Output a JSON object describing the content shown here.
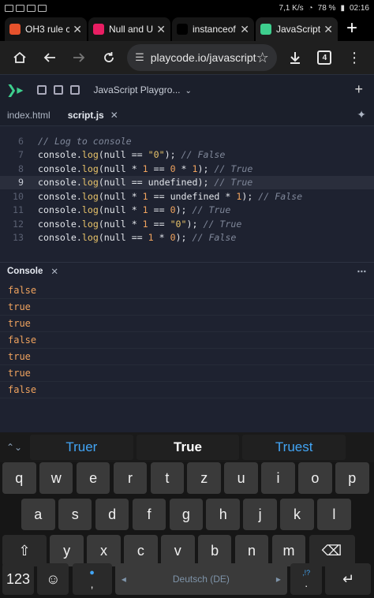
{
  "statusbar": {
    "net_speed": "7,1 K/s",
    "battery": "78 %",
    "time": "02:16"
  },
  "browser_tabs": [
    {
      "label": "OH3 rule c",
      "favicon": "openhab-icon",
      "fav_color": "#e6522c"
    },
    {
      "label": "Null and Ur",
      "favicon": "cube-icon",
      "fav_color": "#e91e63"
    },
    {
      "label": "instanceof",
      "favicon": "mdn-icon",
      "fav_color": "#000000"
    },
    {
      "label": "JavaScript",
      "favicon": "playcode-icon",
      "fav_color": "#3ecf8e"
    }
  ],
  "urlbar": {
    "url": "playcode.io/javascript",
    "tab_count": "4"
  },
  "app": {
    "project_title": "JavaScript Playgro..."
  },
  "file_tabs": [
    {
      "label": "index.html"
    },
    {
      "label": "script.js"
    }
  ],
  "code_lines": [
    {
      "num": "6",
      "current": false,
      "tokens": [
        {
          "t": "// Log to console",
          "k": "cm"
        }
      ]
    },
    {
      "num": "7",
      "current": false,
      "tokens": [
        {
          "t": "console",
          "k": "plain"
        },
        {
          "t": ".",
          "k": "op"
        },
        {
          "t": "log",
          "k": "fn"
        },
        {
          "t": "(",
          "k": "op"
        },
        {
          "t": "null",
          "k": "plain"
        },
        {
          "t": " == ",
          "k": "op"
        },
        {
          "t": "\"0\"",
          "k": "str"
        },
        {
          "t": "); ",
          "k": "op"
        },
        {
          "t": "// False",
          "k": "cm"
        }
      ]
    },
    {
      "num": "8",
      "current": false,
      "tokens": [
        {
          "t": "console",
          "k": "plain"
        },
        {
          "t": ".",
          "k": "op"
        },
        {
          "t": "log",
          "k": "fn"
        },
        {
          "t": "(",
          "k": "op"
        },
        {
          "t": "null",
          "k": "plain"
        },
        {
          "t": " * ",
          "k": "op"
        },
        {
          "t": "1",
          "k": "num"
        },
        {
          "t": " == ",
          "k": "op"
        },
        {
          "t": "0",
          "k": "num"
        },
        {
          "t": " * ",
          "k": "op"
        },
        {
          "t": "1",
          "k": "num"
        },
        {
          "t": "); ",
          "k": "op"
        },
        {
          "t": "// True",
          "k": "cm"
        }
      ]
    },
    {
      "num": "9",
      "current": true,
      "tokens": [
        {
          "t": "console",
          "k": "plain"
        },
        {
          "t": ".",
          "k": "op"
        },
        {
          "t": "log",
          "k": "fn"
        },
        {
          "t": "(",
          "k": "op"
        },
        {
          "t": "null",
          "k": "plain"
        },
        {
          "t": " == ",
          "k": "op"
        },
        {
          "t": "undefined",
          "k": "plain"
        },
        {
          "t": "); ",
          "k": "op"
        },
        {
          "t": "// True",
          "k": "cm"
        }
      ]
    },
    {
      "num": "10",
      "current": false,
      "tokens": [
        {
          "t": "console",
          "k": "plain"
        },
        {
          "t": ".",
          "k": "op"
        },
        {
          "t": "log",
          "k": "fn"
        },
        {
          "t": "(",
          "k": "op"
        },
        {
          "t": "null",
          "k": "plain"
        },
        {
          "t": " * ",
          "k": "op"
        },
        {
          "t": "1",
          "k": "num"
        },
        {
          "t": " == ",
          "k": "op"
        },
        {
          "t": "undefined",
          "k": "plain"
        },
        {
          "t": " * ",
          "k": "op"
        },
        {
          "t": "1",
          "k": "num"
        },
        {
          "t": "); ",
          "k": "op"
        },
        {
          "t": "// False",
          "k": "cm"
        }
      ]
    },
    {
      "num": "11",
      "current": false,
      "tokens": [
        {
          "t": "console",
          "k": "plain"
        },
        {
          "t": ".",
          "k": "op"
        },
        {
          "t": "log",
          "k": "fn"
        },
        {
          "t": "(",
          "k": "op"
        },
        {
          "t": "null",
          "k": "plain"
        },
        {
          "t": " * ",
          "k": "op"
        },
        {
          "t": "1",
          "k": "num"
        },
        {
          "t": " == ",
          "k": "op"
        },
        {
          "t": "0",
          "k": "num"
        },
        {
          "t": "); ",
          "k": "op"
        },
        {
          "t": "// True",
          "k": "cm"
        }
      ]
    },
    {
      "num": "12",
      "current": false,
      "tokens": [
        {
          "t": "console",
          "k": "plain"
        },
        {
          "t": ".",
          "k": "op"
        },
        {
          "t": "log",
          "k": "fn"
        },
        {
          "t": "(",
          "k": "op"
        },
        {
          "t": "null",
          "k": "plain"
        },
        {
          "t": " * ",
          "k": "op"
        },
        {
          "t": "1",
          "k": "num"
        },
        {
          "t": " == ",
          "k": "op"
        },
        {
          "t": "\"0\"",
          "k": "str"
        },
        {
          "t": "); ",
          "k": "op"
        },
        {
          "t": "// True",
          "k": "cm"
        }
      ]
    },
    {
      "num": "13",
      "current": false,
      "tokens": [
        {
          "t": "console",
          "k": "plain"
        },
        {
          "t": ".",
          "k": "op"
        },
        {
          "t": "log",
          "k": "fn"
        },
        {
          "t": "(",
          "k": "op"
        },
        {
          "t": "null",
          "k": "plain"
        },
        {
          "t": " == ",
          "k": "op"
        },
        {
          "t": "1",
          "k": "num"
        },
        {
          "t": " * ",
          "k": "op"
        },
        {
          "t": "0",
          "k": "num"
        },
        {
          "t": "); ",
          "k": "op"
        },
        {
          "t": "// False",
          "k": "cm"
        }
      ]
    }
  ],
  "console": {
    "title": "Console",
    "output": [
      "false",
      "true",
      "true",
      "false",
      "true",
      "true",
      "false"
    ]
  },
  "keyboard": {
    "suggestions": [
      "Truer",
      "True",
      "Truest"
    ],
    "row1": [
      "q",
      "w",
      "e",
      "r",
      "t",
      "z",
      "u",
      "i",
      "o",
      "p"
    ],
    "row2": [
      "a",
      "s",
      "d",
      "f",
      "g",
      "h",
      "j",
      "k",
      "l"
    ],
    "row3": [
      "y",
      "x",
      "c",
      "v",
      "b",
      "n",
      "m"
    ],
    "numbers_label": "123",
    "comma": ",",
    "period": ".",
    "punct_hint": ",!?",
    "space_label": "Deutsch (DE)"
  }
}
